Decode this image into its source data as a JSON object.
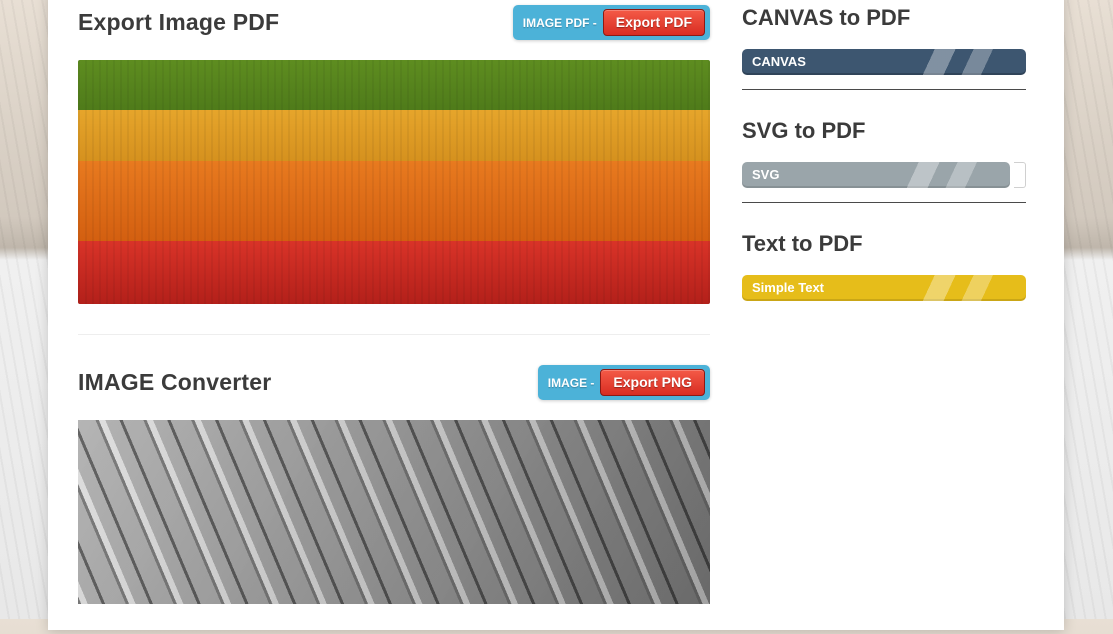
{
  "left": {
    "export_image_pdf": {
      "title": "Export Image PDF",
      "pill_label": "IMAGE PDF -",
      "button_label": "Export PDF"
    },
    "image_converter": {
      "title": "IMAGE Converter",
      "pill_label": "IMAGE -",
      "button_label": "Export PNG"
    }
  },
  "sidebar": {
    "items": [
      {
        "title": "CANVAS to PDF",
        "chip": "CANVAS",
        "chip_kind": "navy"
      },
      {
        "title": "SVG to PDF",
        "chip": "SVG",
        "chip_kind": "grey"
      },
      {
        "title": "Text to PDF",
        "chip": "Simple Text",
        "chip_kind": "gold2"
      }
    ]
  }
}
